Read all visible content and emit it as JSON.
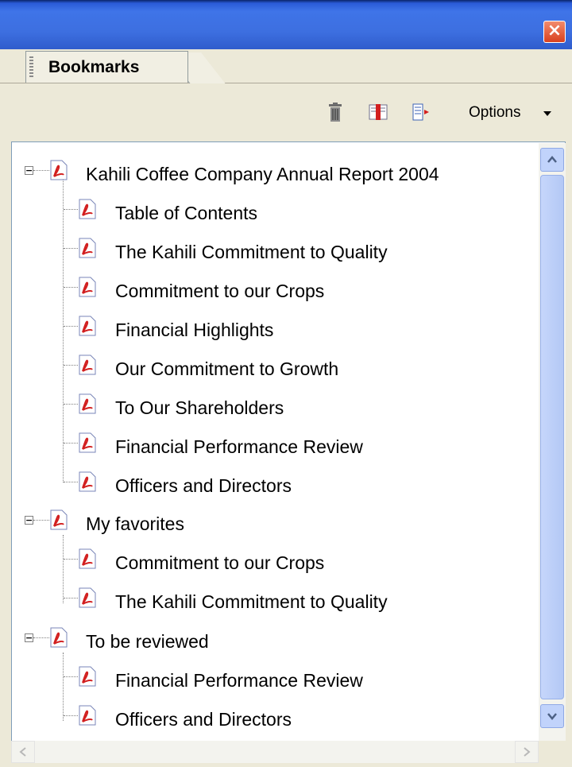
{
  "window": {
    "close_icon": "close-icon"
  },
  "tab": {
    "label": "Bookmarks"
  },
  "toolbar": {
    "delete_icon": "trash-icon",
    "expand_icon": "new-bookmark-icon",
    "add_icon": "expand-bookmark-icon",
    "options_label": "Options"
  },
  "tree": {
    "groups": [
      {
        "label": "Kahili Coffee Company Annual Report 2004",
        "children": [
          {
            "label": "Table of Contents"
          },
          {
            "label": "The Kahili Commitment to Quality"
          },
          {
            "label": "Commitment to our Crops"
          },
          {
            "label": "Financial Highlights"
          },
          {
            "label": "Our Commitment to Growth"
          },
          {
            "label": "To Our Shareholders"
          },
          {
            "label": "Financial Performance Review"
          },
          {
            "label": "Officers and Directors"
          }
        ]
      },
      {
        "label": "My favorites",
        "children": [
          {
            "label": "Commitment to our Crops"
          },
          {
            "label": "The Kahili Commitment to Quality"
          }
        ]
      },
      {
        "label": "To be reviewed",
        "children": [
          {
            "label": "Financial Performance Review"
          },
          {
            "label": "Officers and Directors"
          }
        ]
      }
    ]
  },
  "colors": {
    "titlebar": "#3d6fe0",
    "panel": "#ece9d8",
    "pdf_red": "#d21f1f"
  }
}
